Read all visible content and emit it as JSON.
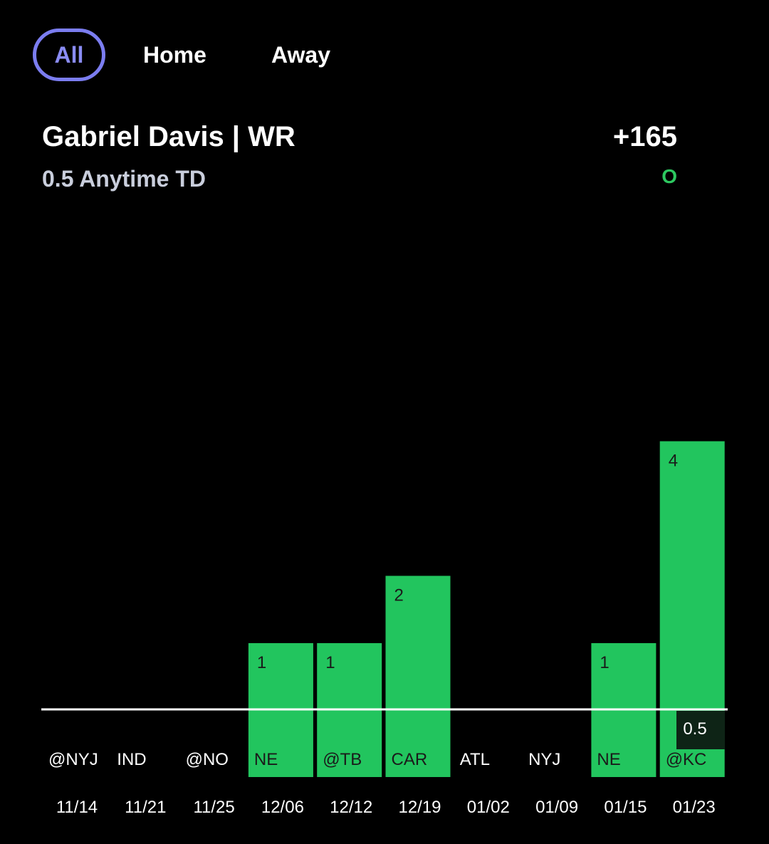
{
  "tabs": [
    {
      "label": "All",
      "active": true
    },
    {
      "label": "Home",
      "active": false
    },
    {
      "label": "Away",
      "active": false
    }
  ],
  "player": {
    "title": "Gabriel Davis | WR",
    "subtitle": "0.5 Anytime TD",
    "odds": "+165",
    "result": "O"
  },
  "colors": {
    "accent": "#7b7df0",
    "bar": "#22c55e",
    "over": "#2dc860",
    "background": "#000000"
  },
  "chart_data": {
    "type": "bar",
    "categories": [
      "11/14",
      "11/21",
      "11/25",
      "12/06",
      "12/12",
      "12/19",
      "01/02",
      "01/09",
      "01/15",
      "01/23"
    ],
    "opponents": [
      "@NYJ",
      "IND",
      "@NO",
      "NE",
      "@TB",
      "CAR",
      "ATL",
      "NYJ",
      "NE",
      "@KC"
    ],
    "values": [
      0,
      0,
      0,
      1,
      1,
      2,
      0,
      0,
      1,
      4
    ],
    "threshold": 0.5,
    "threshold_label": "0.5",
    "ylim": [
      0,
      4
    ]
  }
}
